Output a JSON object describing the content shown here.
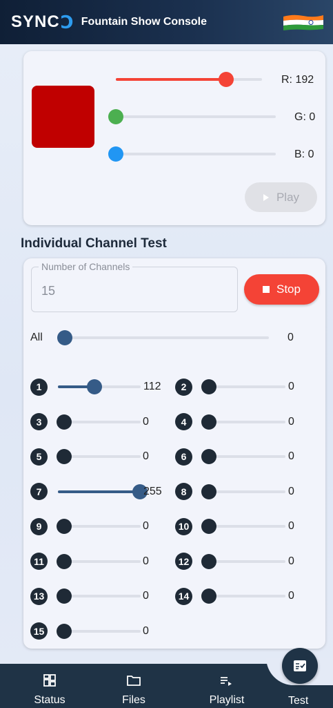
{
  "header": {
    "logo_text": "SYNC",
    "logo_mark": "Ↄ",
    "title": "Fountain Show Console",
    "flag_icon": "india-flag-icon"
  },
  "colors": {
    "accent": "#f44336",
    "swatch": "#c00000",
    "red": "#f44336",
    "green": "#4caf50",
    "blue": "#2196f3",
    "channel": "#355b87",
    "nav": "#1f3346"
  },
  "color_test": {
    "r": {
      "label": "R: 192",
      "value": 192
    },
    "g": {
      "label": "G: 0",
      "value": 0
    },
    "b": {
      "label": "B: 0",
      "value": 0
    },
    "max": 255,
    "play_label": "Play"
  },
  "channel_test": {
    "section_title": "Individual Channel Test",
    "num_channels_label": "Number of Channels",
    "num_channels_value": "15",
    "stop_label": "Stop",
    "all_label": "All",
    "all_value": "0",
    "all_level": 0,
    "max": 255,
    "channels": [
      {
        "id": "1",
        "value": 112
      },
      {
        "id": "2",
        "value": 0
      },
      {
        "id": "3",
        "value": 0
      },
      {
        "id": "4",
        "value": 0
      },
      {
        "id": "5",
        "value": 0
      },
      {
        "id": "6",
        "value": 0
      },
      {
        "id": "7",
        "value": 255
      },
      {
        "id": "8",
        "value": 0
      },
      {
        "id": "9",
        "value": 0
      },
      {
        "id": "10",
        "value": 0
      },
      {
        "id": "11",
        "value": 0
      },
      {
        "id": "12",
        "value": 0
      },
      {
        "id": "13",
        "value": 0
      },
      {
        "id": "14",
        "value": 0
      },
      {
        "id": "15",
        "value": 0
      }
    ]
  },
  "nav": {
    "items": [
      {
        "label": "Status",
        "icon": "dashboard-icon"
      },
      {
        "label": "Files",
        "icon": "folder-icon"
      },
      {
        "label": "Playlist",
        "icon": "playlist-play-icon"
      },
      {
        "label": "Test",
        "icon": "fact-check-icon"
      }
    ]
  }
}
